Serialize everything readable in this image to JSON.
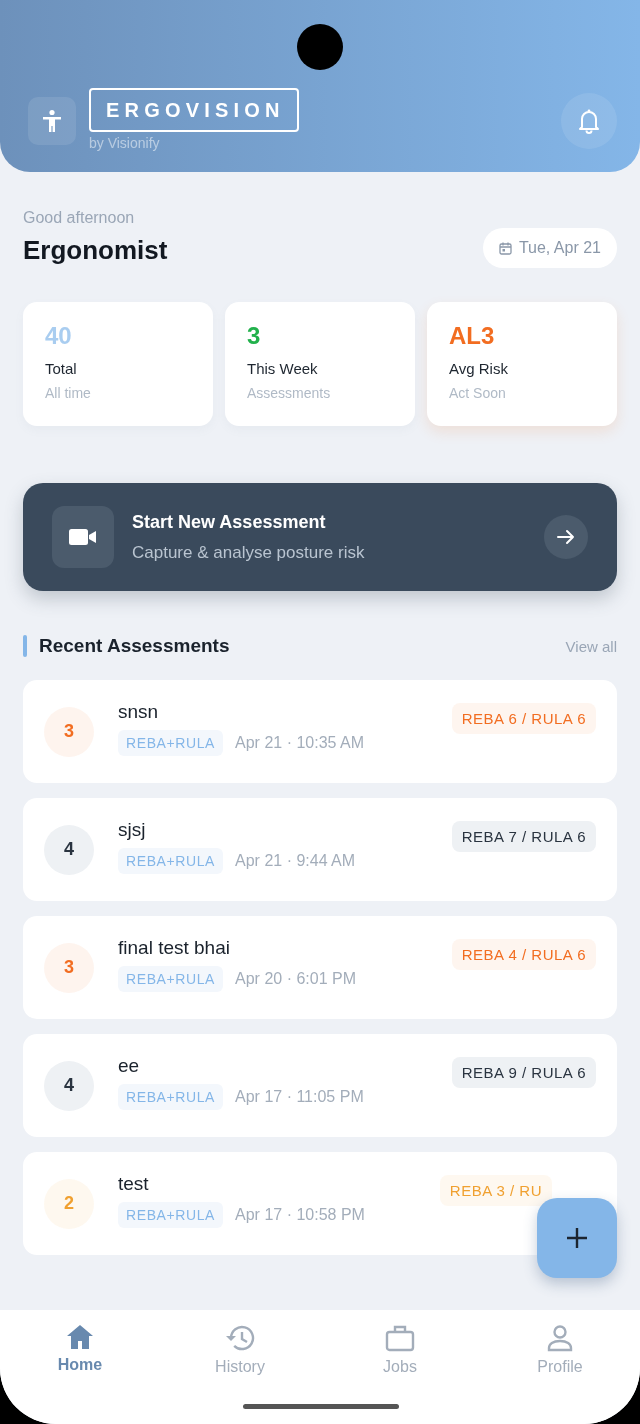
{
  "header": {
    "brand": "ERGOVISION",
    "byline": "by Visionify"
  },
  "greeting": "Good afternoon",
  "user_name": "Ergonomist",
  "date": "Tue, Apr 21",
  "stats": [
    {
      "value": "40",
      "label": "Total",
      "sublabel": "All time",
      "color": "#a9cdf0"
    },
    {
      "value": "3",
      "label": "This Week",
      "sublabel": "Assessments",
      "color": "#22b14c"
    },
    {
      "value": "AL3",
      "label": "Avg Risk",
      "sublabel": "Act Soon",
      "color": "#f26d21"
    }
  ],
  "start_card": {
    "title": "Start New Assessment",
    "subtitle": "Capture & analyse posture risk"
  },
  "recent": {
    "title": "Recent Assessments",
    "link": "View all",
    "items": [
      {
        "action_level": "3",
        "name": "snsn",
        "method": "REBA+RULA",
        "time": "Apr 21 · 10:35 AM",
        "score": "REBA 6 / RULA 6",
        "color": "#f26d21"
      },
      {
        "action_level": "4",
        "name": "sjsj",
        "method": "REBA+RULA",
        "time": "Apr 21 · 9:44 AM",
        "score": "REBA 7 / RULA 6",
        "color": "#2a3440"
      },
      {
        "action_level": "3",
        "name": "final test bhai",
        "method": "REBA+RULA",
        "time": "Apr 20 · 6:01 PM",
        "score": "REBA 4 / RULA 6",
        "color": "#f26d21"
      },
      {
        "action_level": "4",
        "name": "ee",
        "method": "REBA+RULA",
        "time": "Apr 17 · 11:05 PM",
        "score": "REBA 9 / RULA 6",
        "color": "#2a3440"
      },
      {
        "action_level": "2",
        "name": "test",
        "method": "REBA+RULA",
        "time": "Apr 17 · 10:58 PM",
        "score": "REBA 3 / RU",
        "color": "#f0a030"
      }
    ]
  },
  "nav": [
    {
      "label": "Home",
      "selected": true
    },
    {
      "label": "History",
      "selected": false
    },
    {
      "label": "Jobs",
      "selected": false
    },
    {
      "label": "Profile",
      "selected": false
    }
  ]
}
